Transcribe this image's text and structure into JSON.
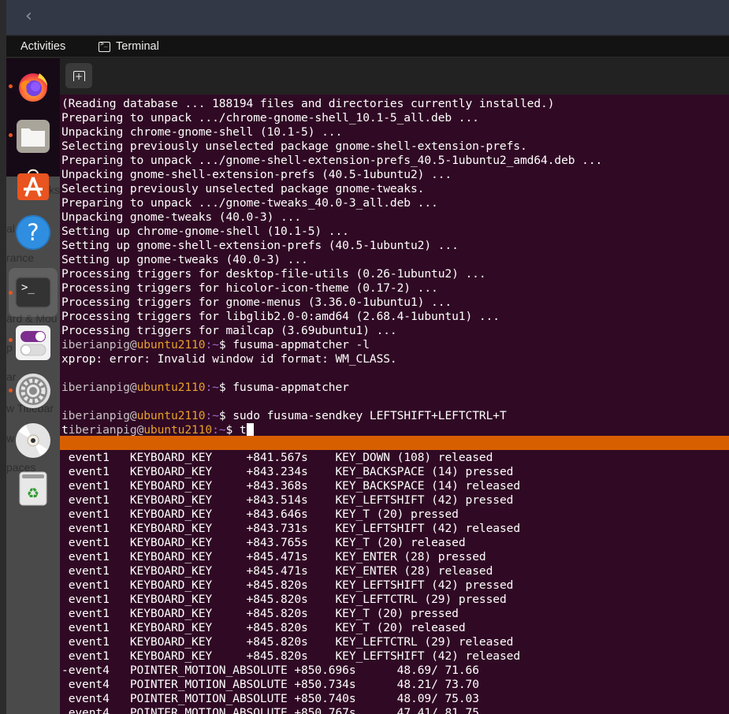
{
  "topbar": {
    "activities_label": "Activities",
    "app_name": "Terminal",
    "app_icon": "terminal-icon"
  },
  "window_behind": {
    "back_icon": "chevron-left-icon",
    "back_glyph": "‹",
    "peek_texts": [
      "ks",
      "al",
      "rance",
      "ard & Mou",
      "p     at",
      "ar",
      "w Titlebar",
      "w",
      "paces"
    ]
  },
  "dock": {
    "items": [
      {
        "name": "firefox",
        "icon": "firefox-icon",
        "running": true
      },
      {
        "name": "files",
        "icon": "files-icon",
        "running": true
      },
      {
        "name": "ubuntu-software",
        "icon": "software-store-icon",
        "running": false
      },
      {
        "name": "help",
        "icon": "help-icon",
        "glyph": "?",
        "running": false
      },
      {
        "name": "terminal",
        "icon": "terminal-icon",
        "glyph": ">_",
        "running": true,
        "active": true
      },
      {
        "name": "tweaks",
        "icon": "tweaks-toggle-icon",
        "running": true
      },
      {
        "name": "settings",
        "icon": "settings-gear-icon",
        "running": true
      },
      {
        "name": "disc",
        "icon": "optical-disc-icon",
        "running": false
      },
      {
        "name": "trash",
        "icon": "trash-icon",
        "running": false
      }
    ]
  },
  "header": {
    "new_tab_icon": "new-tab-icon",
    "new_tab_glyph": "+"
  },
  "terminal_top": {
    "output_lines": [
      "(Reading database ... 188194 files and directories currently installed.)",
      "Preparing to unpack .../chrome-gnome-shell_10.1-5_all.deb ...",
      "Unpacking chrome-gnome-shell (10.1-5) ...",
      "Selecting previously unselected package gnome-shell-extension-prefs.",
      "Preparing to unpack .../gnome-shell-extension-prefs_40.5-1ubuntu2_amd64.deb ...",
      "Unpacking gnome-shell-extension-prefs (40.5-1ubuntu2) ...",
      "Selecting previously unselected package gnome-tweaks.",
      "Preparing to unpack .../gnome-tweaks_40.0-3_all.deb ...",
      "Unpacking gnome-tweaks (40.0-3) ...",
      "Setting up chrome-gnome-shell (10.1-5) ...",
      "Setting up gnome-shell-extension-prefs (40.5-1ubuntu2) ...",
      "Setting up gnome-tweaks (40.0-3) ...",
      "Processing triggers for desktop-file-utils (0.26-1ubuntu2) ...",
      "Processing triggers for hicolor-icon-theme (0.17-2) ...",
      "Processing triggers for gnome-menus (3.36.0-1ubuntu1) ...",
      "Processing triggers for libglib2.0-0:amd64 (2.68.4-1ubuntu1) ...",
      "Processing triggers for mailcap (3.69ubuntu1) ..."
    ],
    "prompt": {
      "user": "iberianpig",
      "at": "@",
      "host": "ubuntu2110",
      "colon": ":",
      "path": "~",
      "dollar": "$ "
    },
    "session": [
      {
        "type": "prompt",
        "prefix": "",
        "command": "fusuma-appmatcher -l"
      },
      {
        "type": "output",
        "text": "xprop: error: Invalid window id format: WM_CLASS."
      },
      {
        "type": "blank",
        "text": ""
      },
      {
        "type": "prompt",
        "prefix": "",
        "command": "fusuma-appmatcher"
      },
      {
        "type": "blank",
        "text": ""
      },
      {
        "type": "prompt",
        "prefix": "",
        "command": "sudo fusuma-sendkey LEFTSHIFT+LEFTCTRL+T"
      },
      {
        "type": "prompt",
        "prefix": "t",
        "command": "t",
        "cursor": true
      }
    ]
  },
  "terminal_bottom": {
    "events": [
      {
        "lead": " ",
        "device": "event1",
        "type": "KEYBOARD_KEY",
        "time": "+841.567s",
        "detail": "KEY_DOWN (108) released"
      },
      {
        "lead": " ",
        "device": "event1",
        "type": "KEYBOARD_KEY",
        "time": "+843.234s",
        "detail": "KEY_BACKSPACE (14) pressed"
      },
      {
        "lead": " ",
        "device": "event1",
        "type": "KEYBOARD_KEY",
        "time": "+843.368s",
        "detail": "KEY_BACKSPACE (14) released"
      },
      {
        "lead": " ",
        "device": "event1",
        "type": "KEYBOARD_KEY",
        "time": "+843.514s",
        "detail": "KEY_LEFTSHIFT (42) pressed"
      },
      {
        "lead": " ",
        "device": "event1",
        "type": "KEYBOARD_KEY",
        "time": "+843.646s",
        "detail": "KEY_T (20) pressed"
      },
      {
        "lead": " ",
        "device": "event1",
        "type": "KEYBOARD_KEY",
        "time": "+843.731s",
        "detail": "KEY_LEFTSHIFT (42) released"
      },
      {
        "lead": " ",
        "device": "event1",
        "type": "KEYBOARD_KEY",
        "time": "+843.765s",
        "detail": "KEY_T (20) released"
      },
      {
        "lead": " ",
        "device": "event1",
        "type": "KEYBOARD_KEY",
        "time": "+845.471s",
        "detail": "KEY_ENTER (28) pressed"
      },
      {
        "lead": " ",
        "device": "event1",
        "type": "KEYBOARD_KEY",
        "time": "+845.471s",
        "detail": "KEY_ENTER (28) released"
      },
      {
        "lead": " ",
        "device": "event1",
        "type": "KEYBOARD_KEY",
        "time": "+845.820s",
        "detail": "KEY_LEFTSHIFT (42) pressed"
      },
      {
        "lead": " ",
        "device": "event1",
        "type": "KEYBOARD_KEY",
        "time": "+845.820s",
        "detail": "KEY_LEFTCTRL (29) pressed"
      },
      {
        "lead": " ",
        "device": "event1",
        "type": "KEYBOARD_KEY",
        "time": "+845.820s",
        "detail": "KEY_T (20) pressed"
      },
      {
        "lead": " ",
        "device": "event1",
        "type": "KEYBOARD_KEY",
        "time": "+845.820s",
        "detail": "KEY_T (20) released"
      },
      {
        "lead": " ",
        "device": "event1",
        "type": "KEYBOARD_KEY",
        "time": "+845.820s",
        "detail": "KEY_LEFTCTRL (29) released"
      },
      {
        "lead": " ",
        "device": "event1",
        "type": "KEYBOARD_KEY",
        "time": "+845.820s",
        "detail": "KEY_LEFTSHIFT (42) released"
      },
      {
        "lead": "-",
        "device": "event4",
        "type": "POINTER_MOTION_ABSOLUTE",
        "time": "+850.696s",
        "detail": "48.69/ 71.66"
      },
      {
        "lead": " ",
        "device": "event4",
        "type": "POINTER_MOTION_ABSOLUTE",
        "time": "+850.734s",
        "detail": "48.21/ 73.70"
      },
      {
        "lead": " ",
        "device": "event4",
        "type": "POINTER_MOTION_ABSOLUTE",
        "time": "+850.740s",
        "detail": "48.09/ 75.03"
      },
      {
        "lead": " ",
        "device": "event4",
        "type": "POINTER_MOTION_ABSOLUTE",
        "time": "+850.767s",
        "detail": "47.41/ 81.75"
      }
    ]
  },
  "colors": {
    "terminal_bg": "#300a24",
    "divider_orange": "#d85f00",
    "prompt_host": "#e89f28",
    "prompt_path": "#9b6bd0",
    "ubuntu_accent": "#e95420"
  }
}
